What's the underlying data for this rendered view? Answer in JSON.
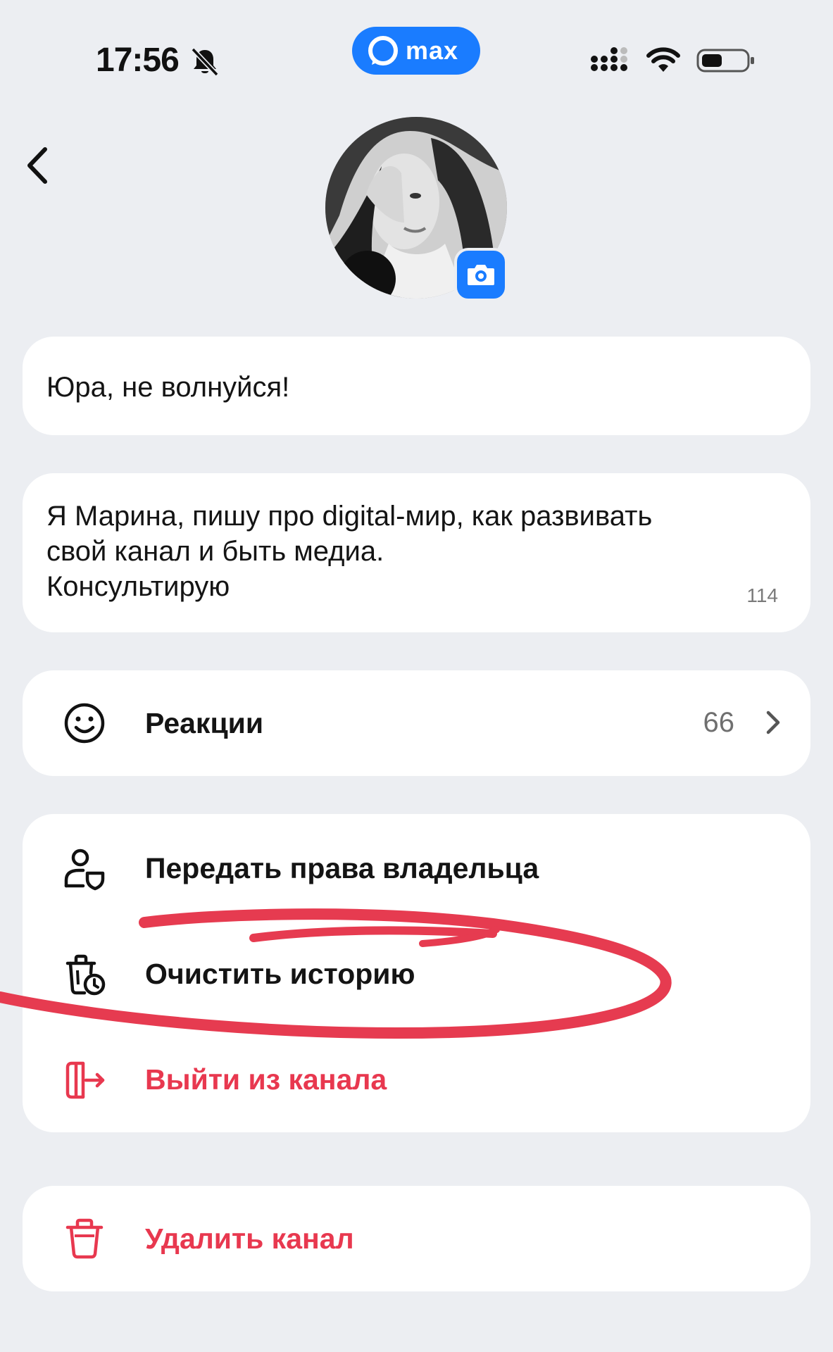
{
  "status_bar": {
    "time": "17:56",
    "brand": "max"
  },
  "profile": {
    "name": "Юра, не волнуйся!",
    "description_lines": [
      "Я Марина, пишу про digital-мир, как развивать",
      "свой канал и быть медиа.",
      "Консультирую"
    ],
    "description_counter": "114"
  },
  "reactions": {
    "label": "Реакции",
    "count": "66"
  },
  "actions": {
    "transfer_owner": "Передать права владельца",
    "clear_history": "Очистить историю",
    "leave_channel": "Выйти из канала"
  },
  "danger": {
    "delete_channel": "Удалить канал"
  },
  "icons": {
    "back": "chevron-left-icon",
    "camera": "camera-icon",
    "reactions": "smiley-icon",
    "transfer": "user-shield-icon",
    "clear": "trash-clock-icon",
    "leave": "exit-door-icon",
    "delete": "trash-icon",
    "bell_off": "bell-off-icon"
  },
  "colors": {
    "background": "#eceef2",
    "accent": "#1a7cff",
    "danger": "#e8384f",
    "annotation": "#e63b50"
  }
}
